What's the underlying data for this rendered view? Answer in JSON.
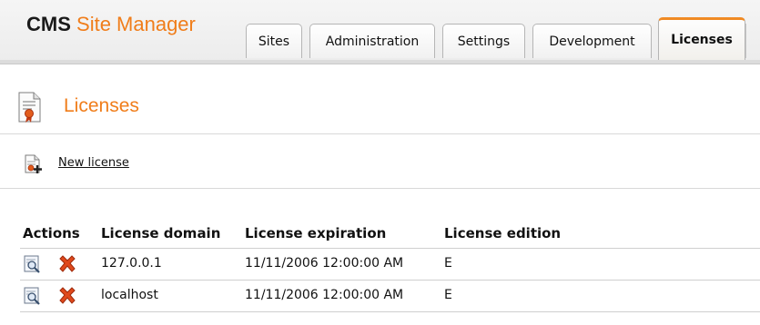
{
  "header": {
    "logo_cms": "CMS",
    "logo_site_manager": "Site Manager",
    "tabs": [
      {
        "label": "Sites"
      },
      {
        "label": "Administration"
      },
      {
        "label": "Settings"
      },
      {
        "label": "Development"
      },
      {
        "label": "Licenses",
        "active": true
      }
    ]
  },
  "page": {
    "title": "Licenses",
    "title_icon": "license-certificate-icon",
    "new_license_label": "New license",
    "new_license_icon": "new-license-icon"
  },
  "table": {
    "columns": [
      "Actions",
      "License domain",
      "License expiration",
      "License edition"
    ],
    "rows": [
      {
        "domain": "127.0.0.1",
        "expiration": "11/11/2006 12:00:00 AM",
        "edition": "E"
      },
      {
        "domain": "localhost",
        "expiration": "11/11/2006 12:00:00 AM",
        "edition": "E"
      }
    ],
    "action_icons": [
      "view-icon",
      "delete-icon"
    ]
  },
  "colors": {
    "brand_orange": "#f07d1a",
    "active_tab_accent": "#f08a24",
    "delete_red": "#d9401c"
  }
}
